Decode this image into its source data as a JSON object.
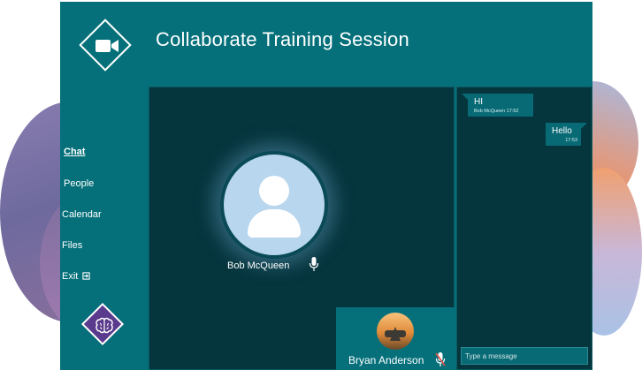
{
  "header": {
    "title": "Collaborate Training Session",
    "logo_icon": "video-camera-icon"
  },
  "nav": {
    "items": [
      {
        "label": "Chat",
        "active": true
      },
      {
        "label": "People",
        "active": false
      },
      {
        "label": "Calendar",
        "active": false
      },
      {
        "label": "Files",
        "active": false
      },
      {
        "label": "Exit",
        "active": false,
        "icon": "exit-icon"
      }
    ],
    "bottom_logo_icon": "brain-icon"
  },
  "stage": {
    "speaker_name": "Bob McQueen",
    "speaker_mic": "microphone-icon",
    "self_name": "Bryan Anderson",
    "self_mic": "microphone-muted-icon"
  },
  "chat": {
    "messages": [
      {
        "text": "HI",
        "meta": "Bob McQueen 17:52",
        "direction": "incoming"
      },
      {
        "text": "Hello",
        "meta": "17:53",
        "direction": "outgoing"
      }
    ],
    "input_placeholder": "Type a message"
  },
  "colors": {
    "primary": "#05707a",
    "panel": "#05353d",
    "bubble": "#086a75",
    "muted_mic": "#d9534f"
  }
}
